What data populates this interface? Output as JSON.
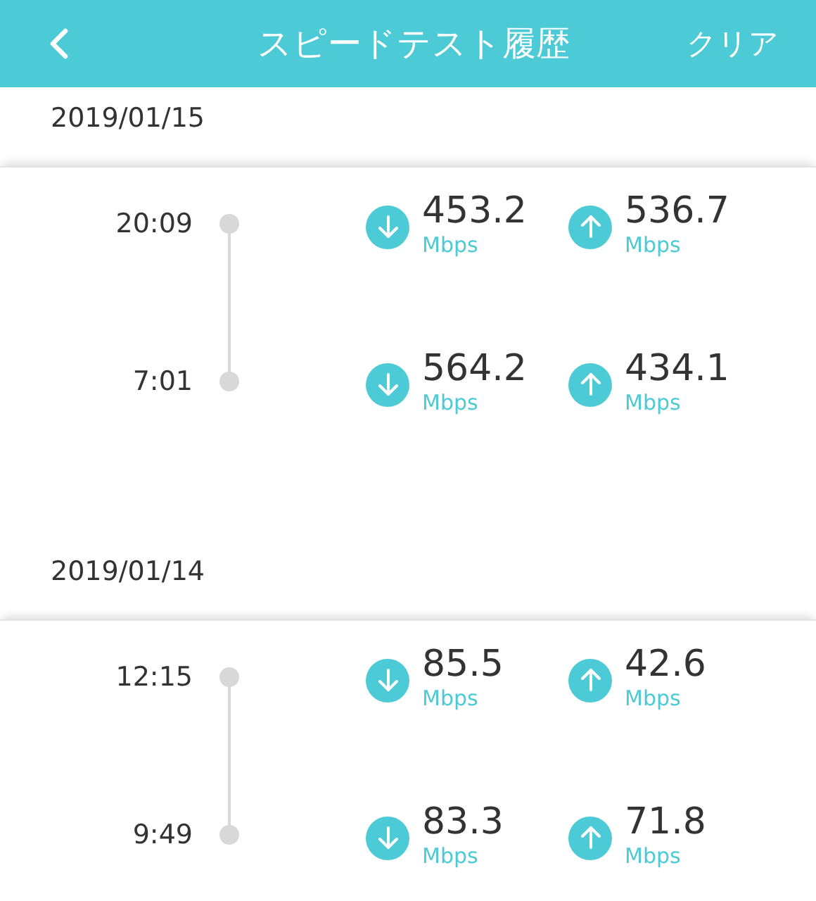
{
  "header": {
    "title": "スピードテスト履歴",
    "action": "クリア"
  },
  "days": [
    {
      "date": "2019/01/15",
      "tests": [
        {
          "time": "20:09",
          "download": "453.2",
          "download_unit": "Mbps",
          "upload": "536.7",
          "upload_unit": "Mbps"
        },
        {
          "time": "7:01",
          "download": "564.2",
          "download_unit": "Mbps",
          "upload": "434.1",
          "upload_unit": "Mbps"
        }
      ]
    },
    {
      "date": "2019/01/14",
      "tests": [
        {
          "time": "12:15",
          "download": "85.5",
          "download_unit": "Mbps",
          "upload": "42.6",
          "upload_unit": "Mbps"
        },
        {
          "time": "9:49",
          "download": "83.3",
          "download_unit": "Mbps",
          "upload": "71.8",
          "upload_unit": "Mbps"
        }
      ]
    }
  ]
}
